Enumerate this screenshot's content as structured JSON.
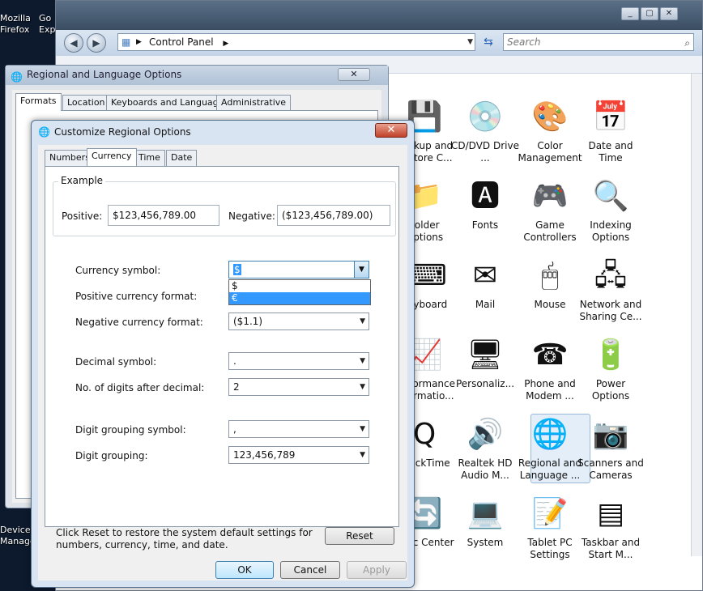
{
  "desktop": {
    "icons": [
      {
        "label": "Mozilla\nFirefox"
      },
      {
        "label": "Go\nExp"
      },
      {
        "label": "Device\nManage..."
      }
    ]
  },
  "control_panel": {
    "title_bg": "Control Panel",
    "address": "Control Panel",
    "search_placeholder": "Search",
    "items": [
      {
        "label": "Backup and Restore C...",
        "icon": "backup-icon",
        "glyph": "💾"
      },
      {
        "label": "CD/DVD Drive ...",
        "icon": "cd-dvd-icon",
        "glyph": "💿"
      },
      {
        "label": "Color Management",
        "icon": "color-management-icon",
        "glyph": "🎨"
      },
      {
        "label": "Date and Time",
        "icon": "date-time-icon",
        "glyph": "📅"
      },
      {
        "label": "Folder Options",
        "icon": "folder-options-icon",
        "glyph": "📁"
      },
      {
        "label": "Fonts",
        "icon": "fonts-icon",
        "glyph": "🅰"
      },
      {
        "label": "Game Controllers",
        "icon": "game-controller-icon",
        "glyph": "🎮"
      },
      {
        "label": "Indexing Options",
        "icon": "indexing-icon",
        "glyph": "🔍"
      },
      {
        "label": "Keyboard",
        "icon": "keyboard-icon",
        "glyph": "⌨"
      },
      {
        "label": "Mail",
        "icon": "mail-icon",
        "glyph": "✉"
      },
      {
        "label": "Mouse",
        "icon": "mouse-icon",
        "glyph": "🖱"
      },
      {
        "label": "Network and Sharing Ce...",
        "icon": "network-icon",
        "glyph": "🖧"
      },
      {
        "label": "Performance Informatio...",
        "icon": "performance-icon",
        "glyph": "📈"
      },
      {
        "label": "Personaliz...",
        "icon": "personalize-icon",
        "glyph": "🖥"
      },
      {
        "label": "Phone and Modem ...",
        "icon": "phone-icon",
        "glyph": "☎"
      },
      {
        "label": "Power Options",
        "icon": "power-icon",
        "glyph": "🔋"
      },
      {
        "label": "QuickTime",
        "icon": "quicktime-icon",
        "glyph": "Q"
      },
      {
        "label": "Realtek HD Audio M...",
        "icon": "audio-icon",
        "glyph": "🔊"
      },
      {
        "label": "Regional and Language ...",
        "icon": "globe-clock-icon",
        "glyph": "🌐"
      },
      {
        "label": "Scanners and Cameras",
        "icon": "scanner-icon",
        "glyph": "📷"
      },
      {
        "label": "Sync Center",
        "icon": "sync-icon",
        "glyph": "🔄"
      },
      {
        "label": "System",
        "icon": "system-icon",
        "glyph": "💻"
      },
      {
        "label": "Tablet PC Settings",
        "icon": "tablet-icon",
        "glyph": "📝"
      },
      {
        "label": "Taskbar and Start M...",
        "icon": "taskbar-icon",
        "glyph": "▤"
      }
    ]
  },
  "regional_dialog": {
    "title": "Regional and Language Options",
    "tabs": [
      "Formats",
      "Location",
      "Keyboards and Languages",
      "Administrative"
    ]
  },
  "customize_dialog": {
    "title": "Customize Regional Options",
    "tabs": [
      "Numbers",
      "Currency",
      "Time",
      "Date"
    ],
    "active_tab": "Currency",
    "example": {
      "group_label": "Example",
      "positive_label": "Positive:",
      "positive_value": "$123,456,789.00",
      "negative_label": "Negative:",
      "negative_value": "($123,456,789.00)"
    },
    "fields": {
      "currency_symbol": {
        "label": "Currency symbol:",
        "value": "$"
      },
      "positive_format": {
        "label": "Positive currency format:"
      },
      "negative_format": {
        "label": "Negative currency format:",
        "value": "($1.1)"
      },
      "decimal_symbol": {
        "label": "Decimal symbol:",
        "value": "."
      },
      "digits_after_decimal": {
        "label": "No. of digits after decimal:",
        "value": "2"
      },
      "grouping_symbol": {
        "label": "Digit grouping symbol:",
        "value": ","
      },
      "digit_grouping": {
        "label": "Digit grouping:",
        "value": "123,456,789"
      }
    },
    "currency_dropdown_options": [
      "$",
      "€"
    ],
    "reset_text_line1": "Click Reset to restore the system default settings for",
    "reset_text_line2": "numbers, currency, time, and date.",
    "buttons": {
      "reset": "Reset",
      "ok": "OK",
      "cancel": "Cancel",
      "apply": "Apply"
    }
  },
  "colors": {
    "selection": "#3399ff",
    "dialog_frame": "#d9e4f2",
    "close_red": "#c0412a"
  }
}
